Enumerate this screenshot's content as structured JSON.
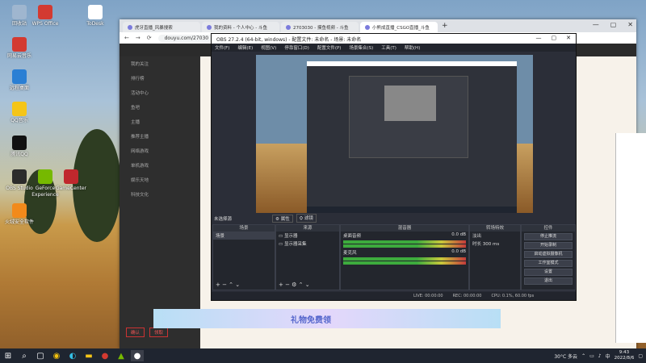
{
  "desktop": {
    "icons": [
      {
        "label": "回收站",
        "color": "#9fb6cf"
      },
      {
        "label": "网易云音乐",
        "color": "#d33a31"
      },
      {
        "label": "远程桌面",
        "color": "#2a7fd4"
      },
      {
        "label": "QQ音乐",
        "color": "#f5c518"
      },
      {
        "label": "腾讯QQ",
        "color": "#111111"
      },
      {
        "label": "OBS Studio",
        "color": "#2b2b2b"
      },
      {
        "label": "GeForce Experience",
        "color": "#76b900"
      },
      {
        "label": "GameCenter",
        "color": "#c0282d"
      },
      {
        "label": "火绒安全软件",
        "color": "#f28a1b"
      },
      {
        "label": "WPS Office",
        "color": "#d33a31"
      },
      {
        "label": "ToDesk",
        "color": "#ffffff"
      }
    ]
  },
  "browser": {
    "tabs": [
      {
        "label": "虎牙直播_风暴搜索",
        "active": false
      },
      {
        "label": "我的资料 - 个人中心 - 斗鱼",
        "active": false
      },
      {
        "label": "2703030 - 摸鱼视频 - 斗鱼",
        "active": false
      },
      {
        "label": "小熊成直播_CSGO直播_斗鱼",
        "active": true
      }
    ],
    "url": "douyu.com/27030",
    "site": {
      "sidebar_items": [
        "我的关注",
        "排行榜",
        "活动中心",
        "鱼吧",
        "主播",
        "推荐主播",
        "网络游戏",
        "单机游戏",
        "娱乐天地",
        "科技文化"
      ],
      "bottom_buttons": [
        "确认",
        "领取"
      ],
      "banner_text": "礼物免费领"
    },
    "controls": {
      "minimize": "—",
      "maximize": "▢",
      "close": "✕"
    }
  },
  "obs": {
    "title": "OBS 27.2.4 (64-bit, windows) - 配置文件: 未命名 - 场景: 未命名",
    "menu": [
      "文件(F)",
      "编辑(E)",
      "视图(V)",
      "停靠窗口(D)",
      "配置文件(P)",
      "场景集合(S)",
      "工具(T)",
      "帮助(H)"
    ],
    "scene_bar": {
      "source_label": "未选择源",
      "props": "属性",
      "filters": "滤镜"
    },
    "docks": {
      "scenes": {
        "header": "场景",
        "items": [
          "场景"
        ]
      },
      "sources": {
        "header": "来源",
        "items": [
          "显示器",
          "显示器采集"
        ]
      },
      "mixer": {
        "header": "混音器",
        "tracks": [
          {
            "name": "桌面音频",
            "db": "0.0 dB"
          },
          {
            "name": "麦克风",
            "db": "0.0 dB"
          }
        ]
      },
      "transitions": {
        "header": "转场特效",
        "type": "淡出",
        "duration_label": "时长",
        "duration": "300 ms"
      },
      "controls": {
        "header": "控件",
        "buttons": [
          "停止推流",
          "开始录制",
          "启动虚拟摄像机",
          "工作室模式",
          "设置",
          "退出"
        ]
      }
    },
    "status": {
      "live": "LIVE: 00:00:00",
      "rec": "REC: 00:00:00",
      "cpu": "CPU: 0.1%, 60.00 fps"
    },
    "controls": {
      "minimize": "—",
      "maximize": "▢",
      "close": "✕"
    }
  },
  "taskbar": {
    "weather": "30°C 多云",
    "language": "中",
    "time": "9:43",
    "date": "2022/8/6"
  }
}
